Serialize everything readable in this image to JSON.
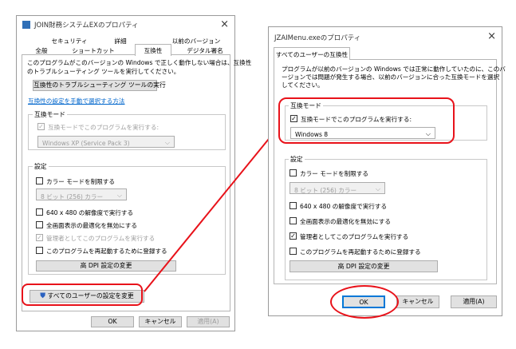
{
  "left_dialog": {
    "title": "JOIN財務システムEXのプロパティ",
    "close_glyph": "×",
    "tabs_row1": [
      "セキュリティ",
      "詳細",
      "以前のバージョン"
    ],
    "tabs_row2": [
      "全般",
      "ショートカット",
      "互換性",
      "デジタル署名"
    ],
    "intro": [
      "このプログラムがこのバージョンの Windows で正しく動作しない場合は、互換性",
      "のトラブルシューティング ツールを実行してください。"
    ],
    "troubleshoot_button": "互換性のトラブルシューティング ツールの実行",
    "manual_link": "互換性の設定を手動で選択する方法",
    "compat_group": "互換モード",
    "compat_check": "互換モードでこのプログラムを実行する:",
    "compat_select": "Windows XP (Service Pack 3)",
    "settings_group": "設定",
    "settings": [
      {
        "label": "カラー モードを制限する",
        "checked": false,
        "disabled": false
      },
      {
        "label": "640 x 480 の解像度で実行する",
        "checked": false,
        "disabled": false
      },
      {
        "label": "全画面表示の最適化を無効にする",
        "checked": false,
        "disabled": false
      },
      {
        "label": "管理者としてこのプログラムを実行する",
        "checked": true,
        "disabled": true
      },
      {
        "label": "このプログラムを再起動するために登録する",
        "checked": false,
        "disabled": false
      }
    ],
    "color_select": "8 ビット (256) カラー",
    "dpi_button": "高 DPI 設定の変更",
    "all_users_button": "すべてのユーザーの設定を変更",
    "ok": "OK",
    "cancel": "キャンセル",
    "apply": "適用(A)"
  },
  "right_dialog": {
    "title": "JZAIMenu.exeのプロパティ",
    "close_glyph": "×",
    "tab": "すべてのユーザーの互換性",
    "intro": [
      "プログラムが以前のバージョンの Windows では正常に動作していたのに、このバ",
      "ージョンでは問題が発生する場合、以前のバージョンに合った互換モードを選択",
      "してください。"
    ],
    "compat_group": "互換モード",
    "compat_check": "互換モードでこのプログラムを実行する:",
    "compat_select": "Windows 8",
    "settings_group": "設定",
    "settings": [
      {
        "label": "カラー モードを制限する",
        "checked": false
      },
      {
        "label": "640 x 480 の解像度で実行する",
        "checked": false
      },
      {
        "label": "全画面表示の最適化を無効にする",
        "checked": false
      },
      {
        "label": "管理者としてこのプログラムを実行する",
        "checked": true
      },
      {
        "label": "このプログラムを再起動するために登録する",
        "checked": false
      }
    ],
    "color_select": "8 ビット (256) カラー",
    "dpi_button": "高 DPI 設定の変更",
    "ok": "OK",
    "cancel": "キャンセル",
    "apply": "適用(A)"
  },
  "check_glyph": "✓",
  "highlight_color": "#e8121a"
}
